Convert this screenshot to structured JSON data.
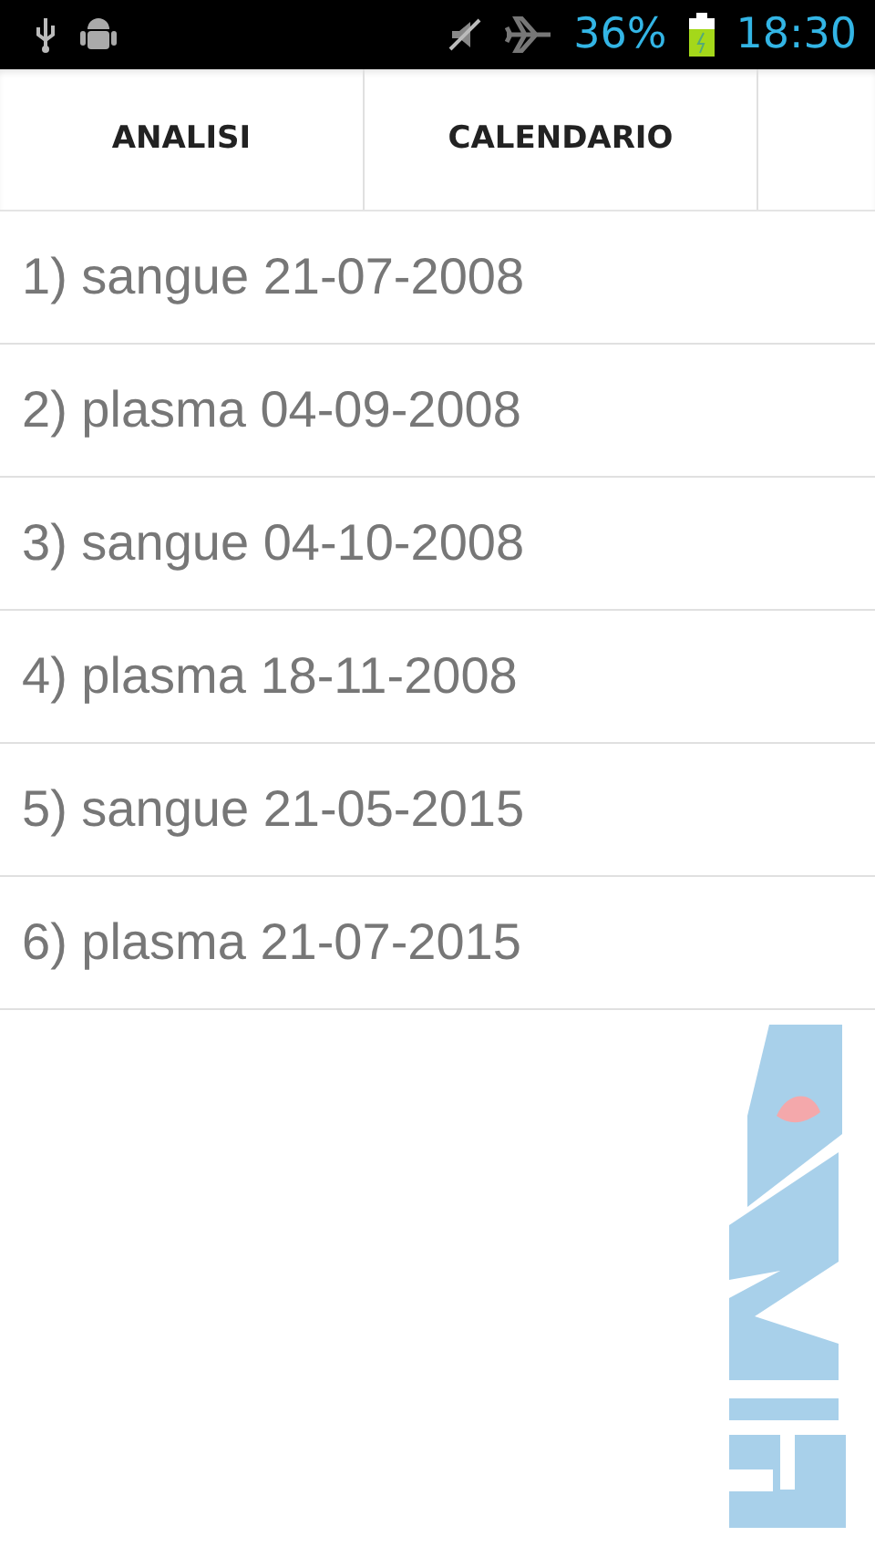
{
  "status_bar": {
    "battery_percent": "36%",
    "time": "18:30"
  },
  "tabs": [
    {
      "label": "ANALISI"
    },
    {
      "label": "CALENDARIO"
    }
  ],
  "list": [
    {
      "text": "1) sangue 21-07-2008"
    },
    {
      "text": "2) plasma 04-09-2008"
    },
    {
      "text": "3) sangue 04-10-2008"
    },
    {
      "text": "4) plasma 18-11-2008"
    },
    {
      "text": "5) sangue 21-05-2015"
    },
    {
      "text": "6) plasma 21-07-2015"
    }
  ]
}
